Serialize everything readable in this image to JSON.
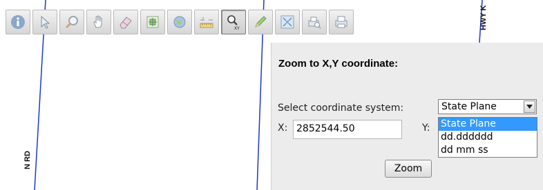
{
  "map": {
    "road_labels": [
      "N RD",
      "HWY K"
    ]
  },
  "toolbar": {
    "tools": [
      {
        "name": "identify",
        "icon": "info-icon"
      },
      {
        "name": "select",
        "icon": "arrow-pointer-icon"
      },
      {
        "name": "zoom",
        "icon": "magnifier-icon"
      },
      {
        "name": "pan",
        "icon": "hand-icon"
      },
      {
        "name": "clear",
        "icon": "eraser-icon"
      },
      {
        "name": "zoom-extent",
        "icon": "map-extent-icon"
      },
      {
        "name": "full-view",
        "icon": "globe-icon"
      },
      {
        "name": "measure",
        "icon": "ruler-icon"
      },
      {
        "name": "zoom-xy",
        "icon": "magnifier-xy-icon",
        "active": true,
        "sub_label": "XY"
      },
      {
        "name": "markup",
        "icon": "pencil-icon"
      },
      {
        "name": "overview",
        "icon": "overview-map-icon"
      },
      {
        "name": "print-preview",
        "icon": "print-preview-icon"
      },
      {
        "name": "print",
        "icon": "printer-icon"
      }
    ]
  },
  "zoom_panel": {
    "title": "Zoom to X,Y coordinate:",
    "coord_label": "Select coordinate system:",
    "selected_system": "State Plane",
    "options": [
      "State Plane",
      "dd.dddddd",
      "dd mm ss"
    ],
    "x_label": "X:",
    "x_value": "2852544.50",
    "y_label": "Y:",
    "y_value": "",
    "zoom_button": "Zoom"
  },
  "colors": {
    "road": "#1b36d8",
    "highlight": "#3399ff"
  }
}
